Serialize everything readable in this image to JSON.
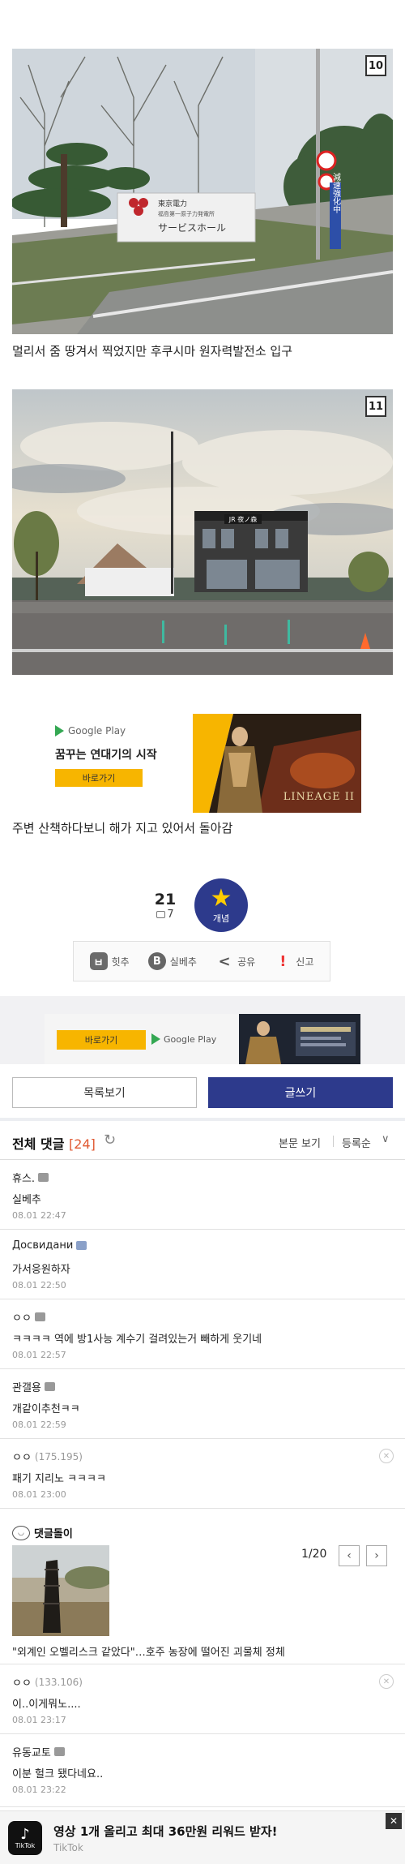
{
  "photos": [
    {
      "number": "10",
      "caption": "멀리서 줌 땅겨서 찍었지만 후쿠시마 원자력발전소 입구",
      "sign_text": "サービスホール",
      "sign_brand": "東京電力",
      "sign_sub": "福島第一原子力発電所",
      "road_sign": "減速強化中"
    },
    {
      "number": "11",
      "caption": "주변 산책하다보니 해가 지고 있어서 돌아감",
      "station_sign": "JR 夜ノ森"
    }
  ],
  "ad": {
    "store": "Google Play",
    "title": "꿈꾸는 연대기의 시작",
    "button": "바로가기",
    "logo": "LINEAGE II"
  },
  "vote": {
    "count": "21",
    "comments": "7",
    "button_label": "개념"
  },
  "actions": [
    {
      "icon": "ㅂ",
      "label": "힛추"
    },
    {
      "icon": "B",
      "label": "실베추"
    },
    {
      "icon": "<",
      "label": "공유"
    },
    {
      "icon": "!",
      "label": "신고"
    }
  ],
  "strip_ad": {
    "button": "바로가기",
    "store": "Google Play"
  },
  "buttons": {
    "list": "목록보기",
    "write": "글쓰기"
  },
  "comments_header": {
    "title": "전체 댓글",
    "count": "[24]",
    "refresh": "↻",
    "view": "본문 보기",
    "sort": "등록순",
    "chevron": "∨"
  },
  "comments": [
    {
      "nick": "휴스.",
      "ip": "",
      "text": "실베추",
      "time": "08.01 22:47"
    },
    {
      "nick": "Досвидани",
      "ip": "",
      "text": "가서응원하자",
      "time": "08.01 22:50"
    },
    {
      "nick": "ㅇㅇ",
      "ip": "",
      "text": "ㅋㅋㅋㅋ 역에 방1사능 계수기 걸려있는거 빼하게 웃기네",
      "time": "08.01 22:57"
    },
    {
      "nick": "관갤용",
      "ip": "",
      "text": "개같이추천ㅋㅋ",
      "time": "08.01 22:59"
    },
    {
      "nick": "ㅇㅇ",
      "ip": "(175.195)",
      "text": "패기 지리노 ㅋㅋㅋㅋ",
      "time": "08.01 23:00"
    }
  ],
  "bot": {
    "name": "댓글돌이",
    "page": "1/20",
    "prev": "‹",
    "next": "›",
    "title": "\"외계인 오벨리스크 같았다\"…호주 농장에 떨어진 괴물체 정체"
  },
  "comments2": [
    {
      "nick": "ㅇㅇ",
      "ip": "(133.106)",
      "text": "이..이게뭐노....",
      "time": "08.01 23:17"
    },
    {
      "nick": "유동교토",
      "ip": "",
      "text": "이분 헐크 됐다네요..",
      "time": "08.01 23:22"
    }
  ],
  "tiktok": {
    "text": "영상 1개 올리고 최대 36만원 리워드 받자!",
    "sub": "TikTok",
    "logo": "TikTok",
    "close": "✕"
  }
}
